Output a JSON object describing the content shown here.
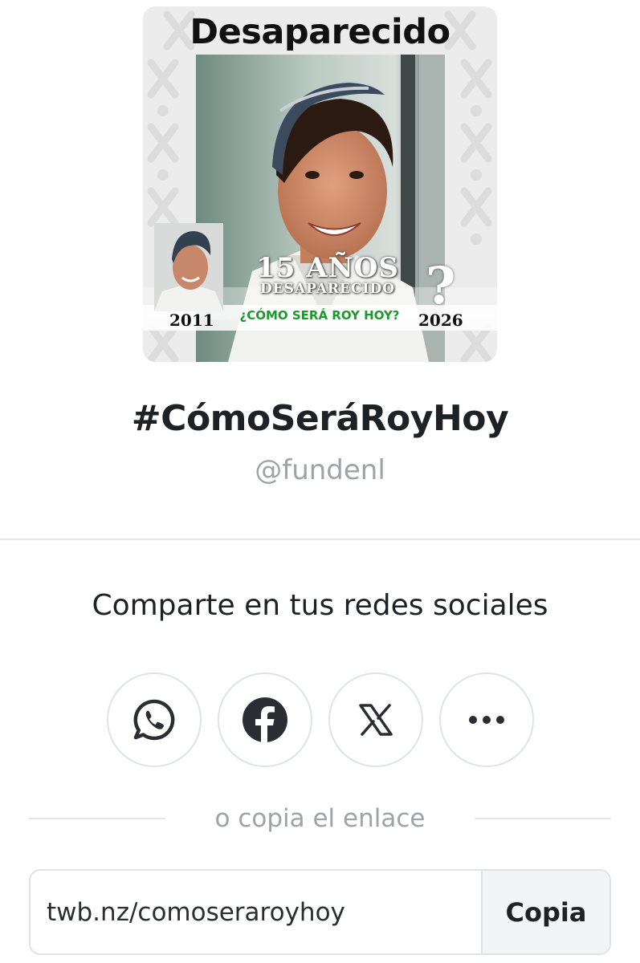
{
  "campaign_image": {
    "title": "Desaparecido",
    "years_text": "15 AÑOS",
    "missing_text": "DESAPARECIDO",
    "question_text": "¿CÓMO SERÁ ROY HOY?",
    "year_start": "2011",
    "year_end": "2026",
    "question_mark": "?"
  },
  "campaign": {
    "title": "#CómoSeráRoyHoy",
    "handle": "@fundenl"
  },
  "share": {
    "heading": "Comparte en tus redes sociales",
    "buttons": [
      {
        "icon": "whatsapp-icon"
      },
      {
        "icon": "facebook-icon"
      },
      {
        "icon": "x-icon"
      },
      {
        "icon": "more-icon"
      }
    ],
    "or_copy_text": "o copia el enlace"
  },
  "link": {
    "url": "twb.nz/comoseraroyhoy",
    "copy_label": "Copia"
  },
  "colors": {
    "heading": "#1e2226",
    "muted": "#9ea3a8",
    "question_green": "#1a9a2a",
    "border": "#dfe4e2"
  }
}
